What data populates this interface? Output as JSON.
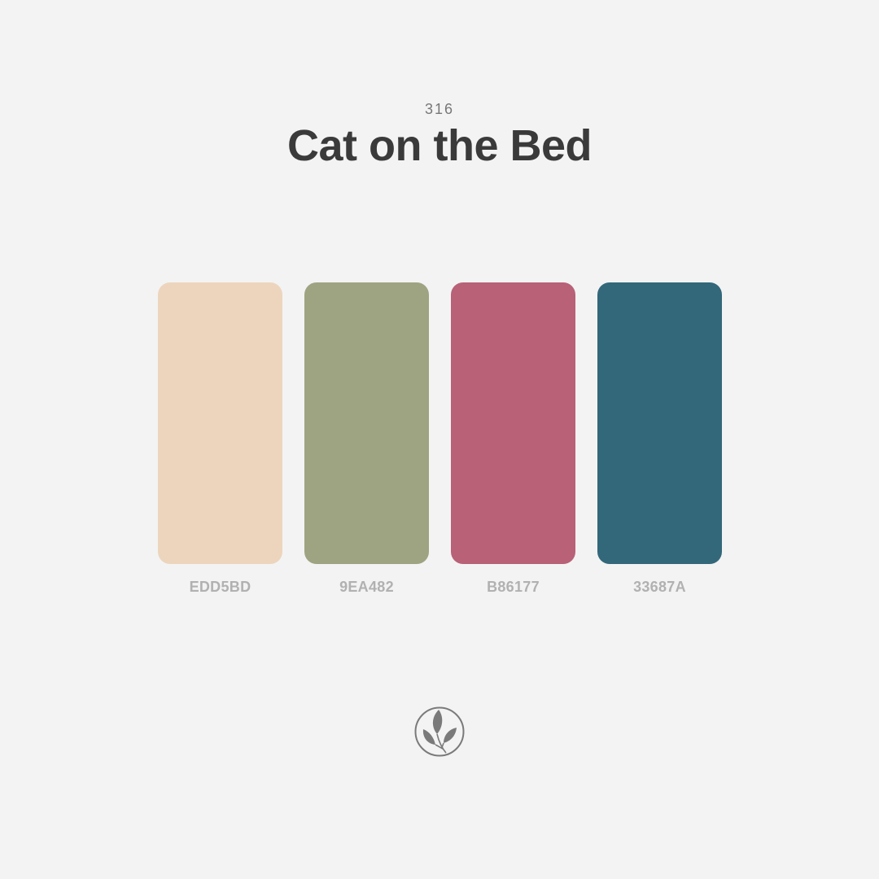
{
  "palette": {
    "number": "316",
    "title": "Cat on the Bed",
    "colors": [
      {
        "hex": "EDD5BD",
        "color": "#EDD5BD"
      },
      {
        "hex": "9EA482",
        "color": "#9EA482"
      },
      {
        "hex": "B86177",
        "color": "#B86177"
      },
      {
        "hex": "33687A",
        "color": "#33687A"
      }
    ]
  },
  "logo": {
    "icon": "leaf-sprig-icon",
    "color": "#7a7a7a"
  }
}
